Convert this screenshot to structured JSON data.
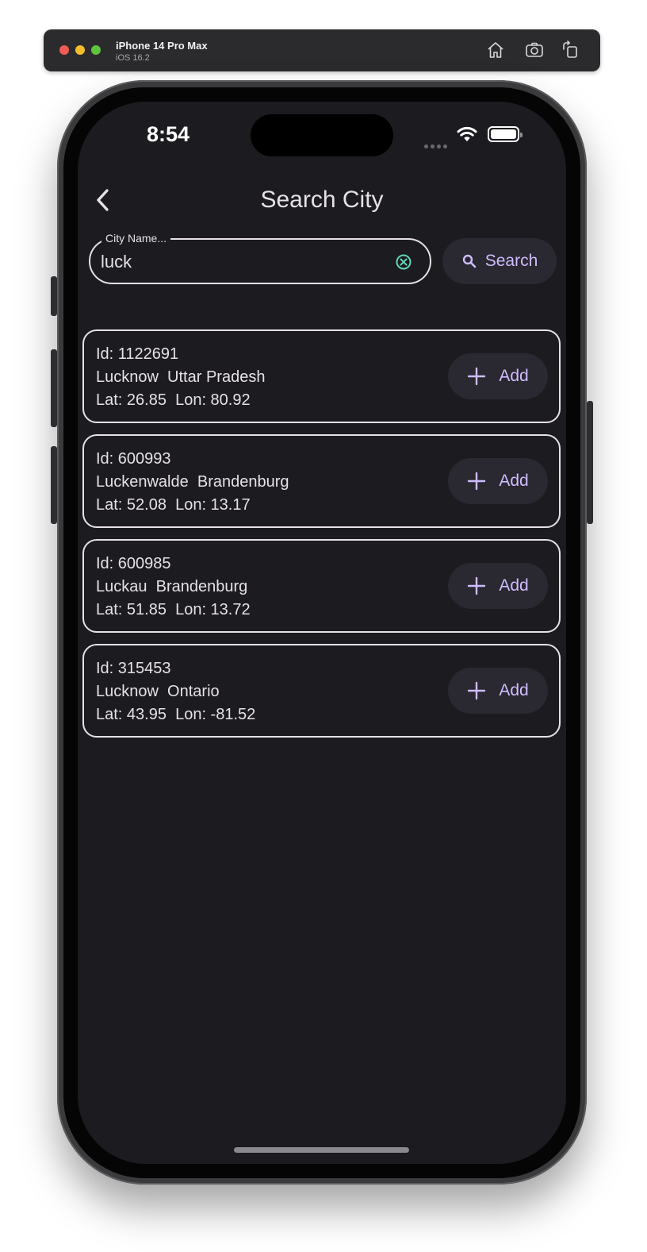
{
  "simulator": {
    "device_name": "iPhone 14 Pro Max",
    "os_version": "iOS 16.2",
    "icons": [
      "home-icon",
      "screenshot-icon",
      "rotate-icon"
    ]
  },
  "status_bar": {
    "time": "8:54"
  },
  "app_bar": {
    "title": "Search City",
    "back_icon": "chevron-left-icon"
  },
  "search": {
    "label": "City Name...",
    "value": "luck",
    "button_label": "Search",
    "clear_icon": "clear-circle-icon",
    "button_icon": "search-icon"
  },
  "results": [
    {
      "id_text": "Id: 1122691",
      "place_text": "Lucknow  Uttar Pradesh",
      "coords_text": "Lat: 26.85  Lon: 80.92",
      "button_label": "Add"
    },
    {
      "id_text": "Id: 600993",
      "place_text": "Luckenwalde  Brandenburg",
      "coords_text": "Lat: 52.08  Lon: 13.17",
      "button_label": "Add"
    },
    {
      "id_text": "Id: 600985",
      "place_text": "Luckau  Brandenburg",
      "coords_text": "Lat: 51.85  Lon: 13.72",
      "button_label": "Add"
    },
    {
      "id_text": "Id: 315453",
      "place_text": "Lucknow  Ontario",
      "coords_text": "Lat: 43.95  Lon: -81.52",
      "button_label": "Add"
    }
  ],
  "colors": {
    "background": "#1c1b20",
    "on_surface": "#e6e1e6",
    "primary": "#cfbcff",
    "tonal_button": "#2a2830",
    "clear_icon": "#5ed8b8"
  }
}
